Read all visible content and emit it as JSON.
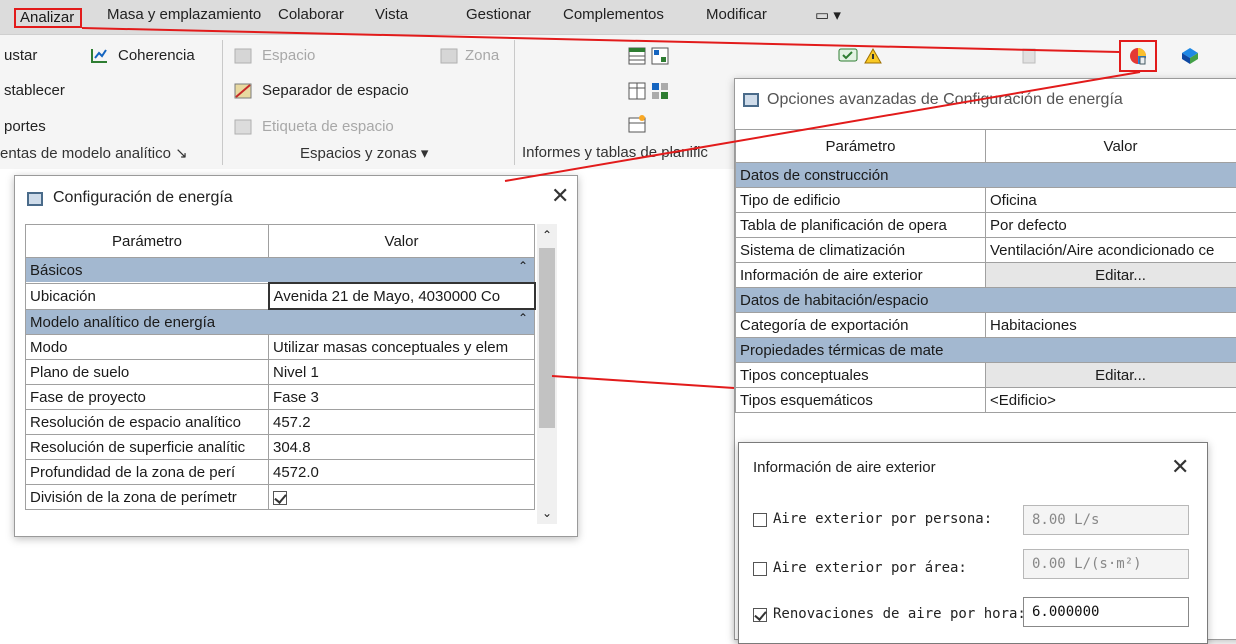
{
  "menu": {
    "items": [
      "Analizar",
      "Masa y emplazamiento",
      "Colaborar",
      "Vista",
      "Gestionar",
      "Complementos",
      "Modificar"
    ],
    "extra": "▭ ▾"
  },
  "ribbon": {
    "col1": [
      "ustar",
      "stablecer",
      "portes"
    ],
    "coherencia": "Coherencia",
    "espacio": "Espacio",
    "zona": "Zona",
    "separador": "Separador de espacio",
    "etiqueta": "Etiqueta de espacio",
    "footer1": "entas de modelo analítico ↘",
    "footer2": "Espacios y zonas ▾",
    "footer3": "Informes y tablas de planific"
  },
  "energy_dialog": {
    "title": "Configuración de energía",
    "col_param": "Parámetro",
    "col_value": "Valor",
    "sections": [
      {
        "name": "Básicos",
        "rows": [
          {
            "param": "Ubicación",
            "value": "Avenida 21 de Mayo, 4030000 Co"
          }
        ]
      },
      {
        "name": "Modelo analítico de energía",
        "rows": [
          {
            "param": "Modo",
            "value": "Utilizar masas conceptuales y elem"
          },
          {
            "param": "Plano de suelo",
            "value": "Nivel 1"
          },
          {
            "param": "Fase de proyecto",
            "value": "Fase 3"
          },
          {
            "param": "Resolución de espacio analítico",
            "value": "457.2"
          },
          {
            "param": "Resolución de superficie analític",
            "value": "304.8"
          },
          {
            "param": "Profundidad de la zona de perí",
            "value": "4572.0"
          },
          {
            "param": "División de la zona de perímetr",
            "value": ""
          }
        ]
      }
    ]
  },
  "advanced_dialog": {
    "title": "Opciones avanzadas de Configuración de energía",
    "col_param": "Parámetro",
    "col_value": "Valor",
    "rows": [
      {
        "type": "section",
        "param": "Datos de construcción"
      },
      {
        "type": "row",
        "param": "Tipo de edificio",
        "value": "Oficina"
      },
      {
        "type": "row",
        "param": "Tabla de planificación de opera",
        "value": "Por defecto"
      },
      {
        "type": "row",
        "param": "Sistema de climatización",
        "value": "Ventilación/Aire acondicionado ce"
      },
      {
        "type": "button",
        "param": "Información de aire exterior",
        "value": "Editar..."
      },
      {
        "type": "section",
        "param": "Datos de habitación/espacio"
      },
      {
        "type": "row",
        "param": "Categoría de exportación",
        "value": "Habitaciones"
      },
      {
        "type": "section",
        "param": "Propiedades térmicas de mate"
      },
      {
        "type": "button",
        "param": "Tipos conceptuales",
        "value": "Editar..."
      },
      {
        "type": "row",
        "param": "Tipos esquemáticos",
        "value": "<Edificio>"
      }
    ]
  },
  "air_dialog": {
    "title": "Información de aire exterior",
    "rows": [
      {
        "label": "Aire exterior por persona:",
        "value": "8.00 L/s",
        "checked": false
      },
      {
        "label": "Aire exterior por área:",
        "value": "0.00 L/(s·m²)",
        "checked": false
      },
      {
        "label": "Renovaciones de aire por hora:",
        "value": "6.000000",
        "checked": true
      }
    ]
  },
  "colors": {
    "highlight": "#e21b1b",
    "section_bg": "#a3b8d0"
  }
}
